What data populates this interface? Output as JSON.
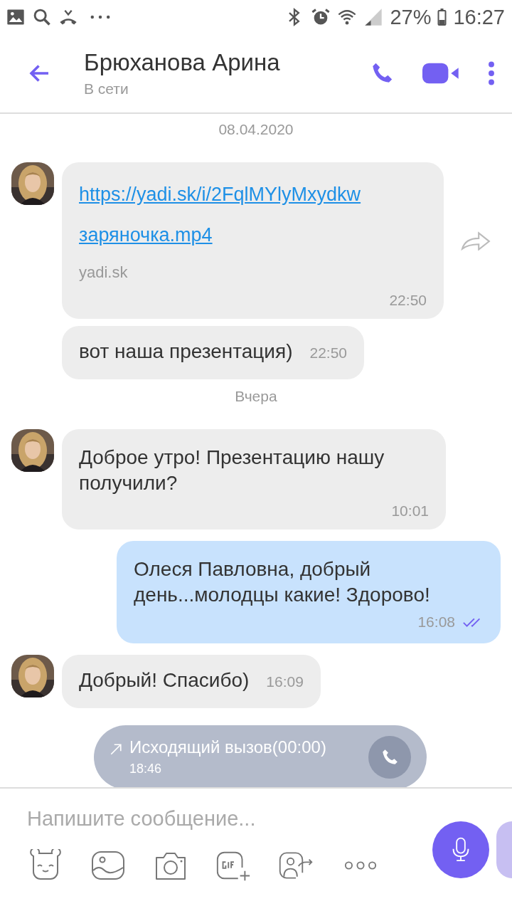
{
  "status_bar": {
    "battery": "27%",
    "time": "16:27"
  },
  "header": {
    "title": "Брюханова Арина",
    "subtitle": "В сети"
  },
  "messages": [
    {
      "kind": "date",
      "text": "08.04.2020"
    },
    {
      "kind": "link",
      "avatar": true,
      "url": "https://yadi.sk/i/2FqlMYlyMxydkw",
      "file": "заряночка.mp4",
      "domain": "yadi.sk",
      "time": "22:50"
    },
    {
      "kind": "text",
      "outgoing": false,
      "avatar": false,
      "text": "вот наша презентация)",
      "time": "22:50",
      "inline_time": true
    },
    {
      "kind": "date",
      "text": "Вчера"
    },
    {
      "kind": "text",
      "outgoing": false,
      "avatar": true,
      "text": "Доброе утро! Презентацию нашу получили?",
      "time": "10:01",
      "inline_time": false
    },
    {
      "kind": "text",
      "outgoing": true,
      "text": "Олеся Павловна, добрый день...молодцы какие! Здорово!",
      "time": "16:08",
      "inline_time": false,
      "read": true
    },
    {
      "kind": "text",
      "outgoing": false,
      "avatar": true,
      "text": "Добрый! Спасибо)",
      "time": "16:09",
      "inline_time": true
    },
    {
      "kind": "call",
      "text": "Исходящий вызов(00:00)",
      "time": "18:46"
    }
  ],
  "composer": {
    "placeholder": "Напишите сообщение..."
  }
}
